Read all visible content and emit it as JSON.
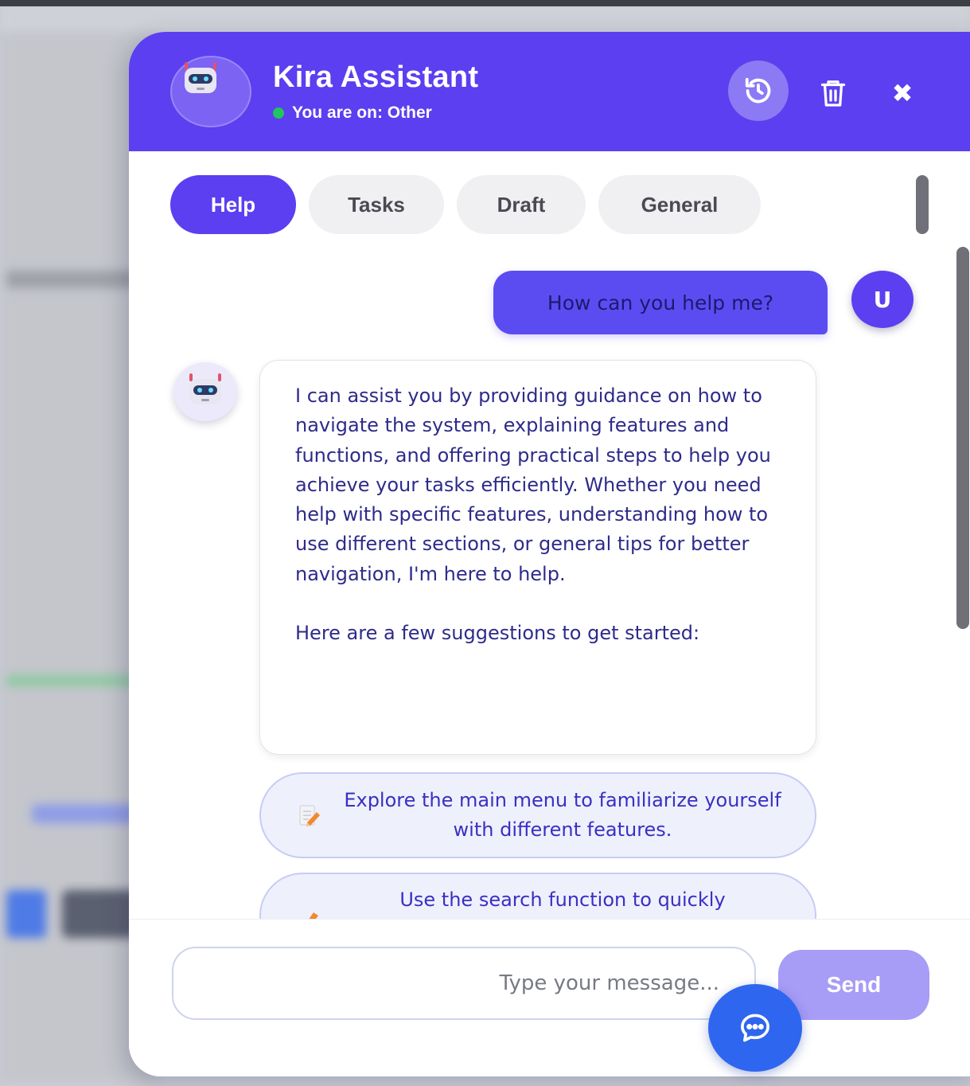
{
  "header": {
    "title": "Kira Assistant",
    "status_text": "You are on: Other",
    "status_color": "#22c55e",
    "accent_color": "#5b3ff0"
  },
  "tabs": [
    {
      "label": "Help",
      "active": true
    },
    {
      "label": "Tasks",
      "active": false
    },
    {
      "label": "Draft",
      "active": false
    },
    {
      "label": "General",
      "active": false
    }
  ],
  "messages": {
    "user": {
      "text": "How can you help me?",
      "avatar_initial": "U"
    },
    "bot": {
      "paragraphs": [
        "I can assist you by providing guidance on how to navigate the system, explaining features and functions, and offering practical steps to help you achieve your tasks efficiently. Whether you need help with specific features, understanding how to use different sections, or general tips for better navigation, I'm here to help.",
        "Here are a few suggestions to get started:"
      ]
    },
    "suggestions": [
      {
        "icon": "memo-pencil-icon",
        "text": "Explore the main menu to familiarize yourself with different features."
      },
      {
        "icon": "pencil-icon",
        "text": "Use the search function to quickly"
      }
    ]
  },
  "input": {
    "placeholder": "...Type your message",
    "value": ""
  },
  "send_button": {
    "label": "Send"
  }
}
